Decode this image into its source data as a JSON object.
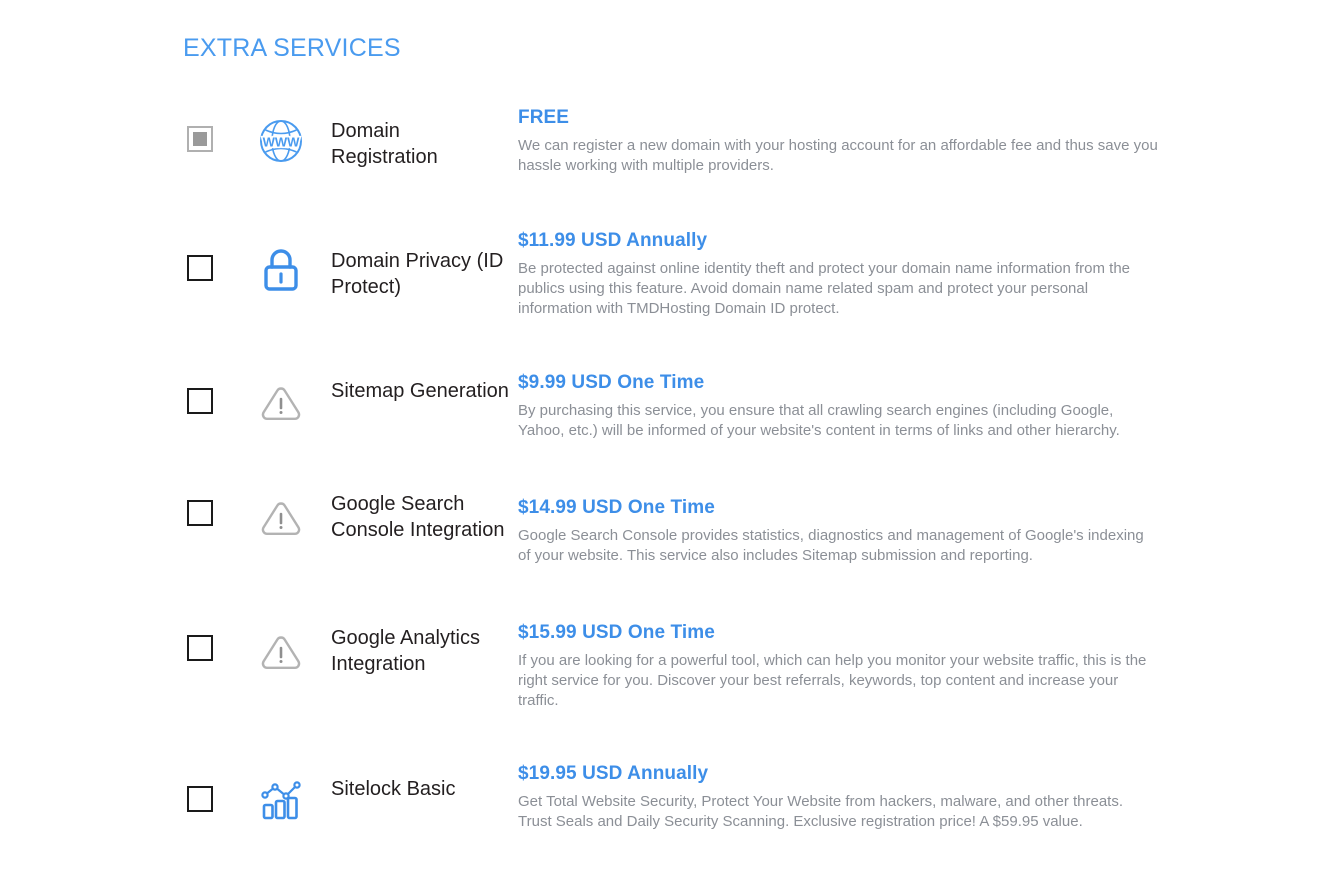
{
  "section": {
    "heading": "EXTRA SERVICES",
    "heading_color": "#4a9bef",
    "price_color": "#3d8ee8",
    "description_color": "#8b8f96",
    "title_color": "#231f20"
  },
  "services": [
    {
      "checkbox_state": "checked-locked",
      "icon": "globe-www-icon",
      "title": "Domain Registration",
      "price": "FREE",
      "description": "We can register a new domain with your hosting account for an affordable fee and thus save you hassle working with multiple providers."
    },
    {
      "checkbox_state": "unchecked",
      "icon": "lock-icon",
      "title": "Domain Privacy (ID Protect)",
      "price": "$11.99 USD Annually",
      "description": "Be protected against online identity theft and protect your domain name information from the publics using this feature. Avoid domain name related spam and protect your personal information with TMDHosting Domain ID protect."
    },
    {
      "checkbox_state": "unchecked",
      "icon": "warning-triangle-icon",
      "title": "Sitemap Generation",
      "price": "$9.99 USD One Time",
      "description": "By purchasing this service, you ensure that all crawling search engines (including Google, Yahoo, etc.) will be informed of your website's content in terms of links and other hierarchy."
    },
    {
      "checkbox_state": "unchecked",
      "icon": "warning-triangle-icon",
      "title": "Google Search Console Integration",
      "price": "$14.99 USD One Time",
      "description": "Google Search Console provides statistics, diagnostics and management of Google's indexing of your website. This service also includes Sitemap submission and reporting."
    },
    {
      "checkbox_state": "unchecked",
      "icon": "warning-triangle-icon",
      "title": "Google Analytics Integration",
      "price": "$15.99 USD One Time",
      "description": "If you are looking for a powerful tool, which can help you monitor your website traffic, this is the right service for you. Discover your best referrals, keywords, top content and increase your traffic."
    },
    {
      "checkbox_state": "unchecked",
      "icon": "bar-chart-line-icon",
      "title": "Sitelock Basic",
      "price": "$19.95 USD Annually",
      "description": "Get Total Website Security, Protect Your Website from hackers, malware, and other threats. Trust Seals and Daily Security Scanning. Exclusive registration price! A $59.95 value."
    }
  ],
  "layout": {
    "row_tops": [
      0,
      130,
      272,
      385,
      518,
      656
    ],
    "checkbox_tops": [
      31,
      160,
      293,
      405,
      540,
      691
    ],
    "icon_tops": [
      21,
      150,
      283,
      398,
      532,
      681
    ],
    "title_tops": [
      23,
      153,
      283,
      396,
      530,
      681
    ],
    "detail_tops": [
      11,
      134,
      276,
      401,
      526,
      667
    ]
  }
}
